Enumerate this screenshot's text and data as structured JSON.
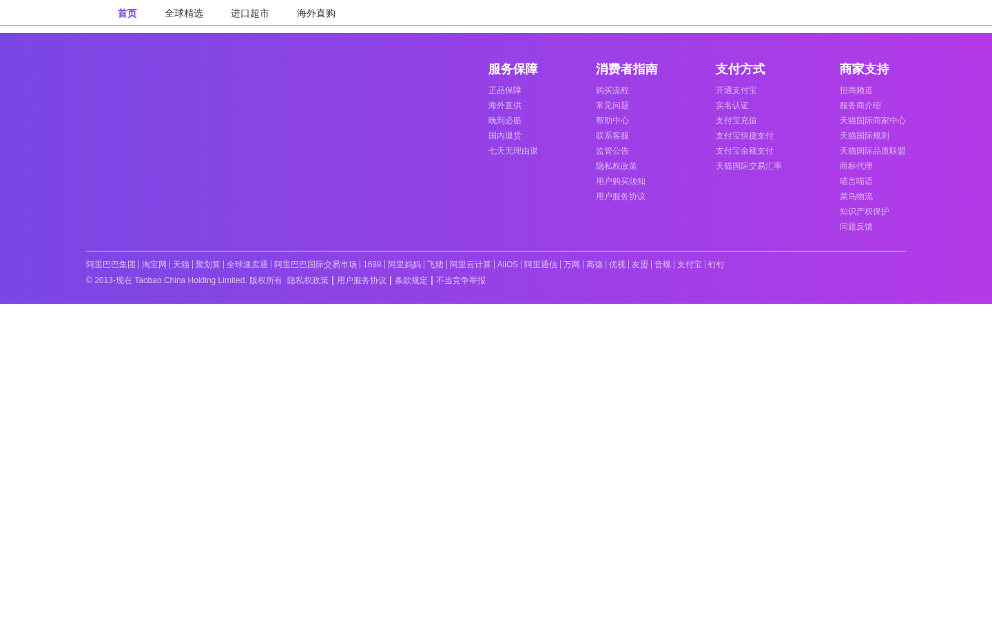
{
  "nav": {
    "items": [
      {
        "label": "首页",
        "selected": true
      },
      {
        "label": "全球精选",
        "selected": false
      },
      {
        "label": "进口超市",
        "selected": false
      },
      {
        "label": "海外直购",
        "selected": false
      }
    ]
  },
  "footer": {
    "columns": [
      {
        "title": "服务保障",
        "links": [
          "正品保障",
          "海外直供",
          "晚到必赔",
          "国内退货",
          "七天无理由退"
        ]
      },
      {
        "title": "消费者指南",
        "links": [
          "购买流程",
          "常见问题",
          "帮助中心",
          "联系客服",
          "监管公告",
          "隐私权政策",
          "用户购买须知",
          "用户服务协议"
        ]
      },
      {
        "title": "支付方式",
        "links": [
          "开通支付宝",
          "实名认证",
          "支付宝充值",
          "支付宝快捷支付",
          "支付宝余额支付",
          "天猫国际交易汇率"
        ]
      },
      {
        "title": "商家支持",
        "links": [
          "招商频道",
          "服务商介绍",
          "天猫国际商家中心",
          "天猫国际规则",
          "天猫国际品质联盟",
          "商标代理",
          "喵言喵语",
          "菜鸟物流",
          "知识产权保护",
          "问题反馈"
        ]
      }
    ],
    "partner_links": [
      "阿里巴巴集团",
      "淘宝网",
      "天猫",
      "聚划算",
      "全球速卖通",
      "阿里巴巴国际交易市场",
      "1688",
      "阿里妈妈",
      "飞猪",
      "阿里云计算",
      "AliOS",
      "阿里通信",
      "万网",
      "高德",
      "优视",
      "友盟",
      "音螺",
      "支付宝",
      "钉钉"
    ],
    "copyright": "© 2013-现在 Taobao China Holding Limited. 版权所有",
    "legal_links": [
      "隐私权政策",
      "用户服务协议",
      "条款规定",
      "不当竞争举报"
    ]
  }
}
